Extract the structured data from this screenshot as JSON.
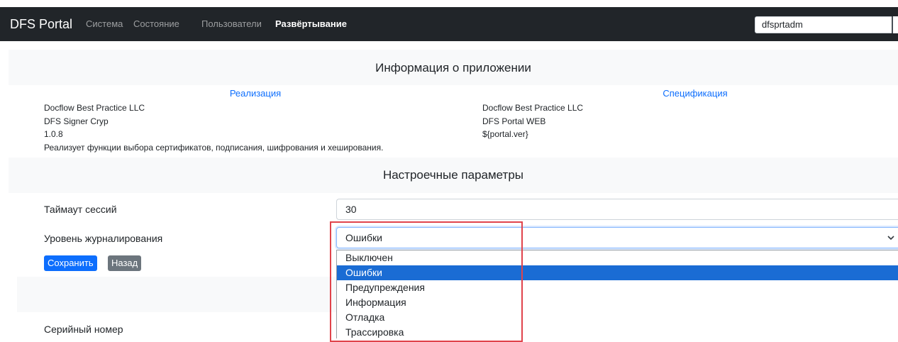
{
  "navbar": {
    "brand": "DFS Portal",
    "links": [
      "Система",
      "Состояние",
      "Пользователи",
      "Развёртывание"
    ],
    "active_link": "Развёртывание",
    "user_value": "dfsprtadm"
  },
  "app_info": {
    "header": "Информация о приложении",
    "implementation": {
      "title": "Реализация",
      "lines": [
        "Docflow Best Practice LLC",
        "DFS Signer Cryp",
        "1.0.8",
        "Реализует функции выбора сертификатов, подписания, шифрования и хеширования."
      ]
    },
    "specification": {
      "title": "Спецификация",
      "lines": [
        "Docflow Best Practice LLC",
        "DFS Portal WEB",
        "${portal.ver}"
      ]
    }
  },
  "settings": {
    "header": "Настроечные параметры",
    "session_timeout_label": "Таймаут сессий",
    "session_timeout_value": "30",
    "log_level_label": "Уровень журналирования",
    "log_level_value": "Ошибки",
    "log_level_options": [
      "Выключен",
      "Ошибки",
      "Предупреждения",
      "Информация",
      "Отладка",
      "Трассировка"
    ],
    "save_label": "Сохранить",
    "back_label": "Назад"
  },
  "license": {
    "serial_label": "Серийный номер"
  },
  "colors": {
    "navbar_bg": "#212529",
    "accent": "#0d6efd",
    "selected_option": "#1a6cd4",
    "annotation_border": "#e0434b"
  }
}
